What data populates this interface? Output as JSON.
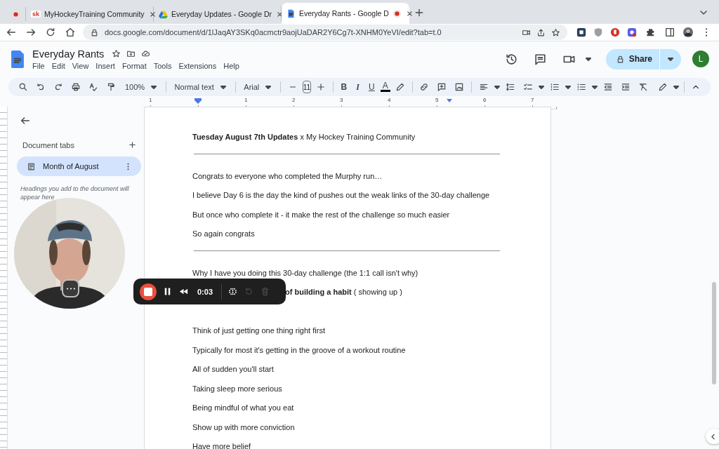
{
  "browser": {
    "tabs": [
      {
        "kind": "pinned",
        "selected": false
      },
      {
        "kind": "sk",
        "favicon_text": "sk",
        "title": "MyHockeyTraining Community",
        "selected": false
      },
      {
        "kind": "drive",
        "title": "Everyday Updates - Google Dr",
        "selected": false
      },
      {
        "kind": "docs",
        "title": "Everyday Rants - Google D",
        "selected": true,
        "recording": true
      }
    ],
    "url": "docs.google.com/document/d/1lJaqAY3SKq0acmctr9aojUaDAR2Y6Cg7t-XNHM0YeVI/edit?tab=t.0"
  },
  "docs": {
    "title": "Everyday Rants",
    "menus": [
      "File",
      "Edit",
      "View",
      "Insert",
      "Format",
      "Tools",
      "Extensions",
      "Help"
    ],
    "share": "Share",
    "avatar": "L"
  },
  "toolbar": {
    "zoom": "100%",
    "style": "Normal text",
    "font": "Arial",
    "size": "11",
    "format": [
      "B",
      "I",
      "U"
    ],
    "text_color": "A"
  },
  "ruler": {
    "labels": [
      "1",
      "1",
      "2",
      "3",
      "4",
      "5",
      "6",
      "7"
    ]
  },
  "sidebar": {
    "heading": "Document tabs",
    "tabs": [
      {
        "label": "Month of August",
        "selected": true
      }
    ],
    "hint": "Headings you add to the document will appear here"
  },
  "document": {
    "blocks": [
      {
        "kind": "paragraph",
        "text": "**Tuesday August 7th Updates** x My Hockey Training Community"
      },
      {
        "kind": "rule"
      },
      {
        "kind": "paragraph",
        "text": "Congrats to everyone who completed the Murphy run…"
      },
      {
        "kind": "paragraph",
        "text": "I believe Day 6 is the day the kind of pushes out the weak links of the 30-day challenge"
      },
      {
        "kind": "paragraph",
        "text": "But once who complete it - it make the rest of the challenge so much easier"
      },
      {
        "kind": "paragraph",
        "text": "So again congrats"
      },
      {
        "kind": "rule"
      },
      {
        "kind": "paragraph",
        "text": "Why I have you doing this 30-day challenge (the 1:1 call isn't why)"
      },
      {
        "kind": "covered",
        "text": "**of building a habit** ( showing up )"
      },
      {
        "kind": "hidden"
      },
      {
        "kind": "paragraph",
        "text": "Think of just getting one thing right first"
      },
      {
        "kind": "paragraph",
        "text": "Typically for most it's getting in the groove of a workout routine"
      },
      {
        "kind": "paragraph",
        "text": "All of sudden you'll start"
      },
      {
        "kind": "paragraph",
        "text": "Taking sleep more serious"
      },
      {
        "kind": "paragraph",
        "text": "Being mindful of what you eat"
      },
      {
        "kind": "paragraph",
        "text": "Show up with more conviction"
      },
      {
        "kind": "paragraph",
        "text": "Have more belief"
      }
    ]
  },
  "recorder": {
    "time": "0:03"
  }
}
